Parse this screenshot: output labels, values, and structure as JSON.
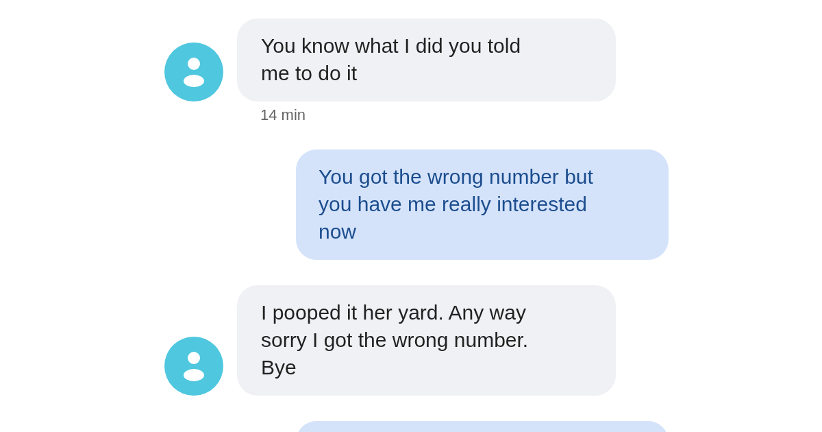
{
  "messages": [
    {
      "kind": "incoming",
      "text": "You know what I did you told\nme to do it",
      "time": "14 min"
    },
    {
      "kind": "outgoing",
      "text": "You got the wrong number but\nyou have me really interested\nnow"
    },
    {
      "kind": "incoming",
      "text": "I pooped it her yard. Any way\nsorry I got the wrong number.\nBye"
    },
    {
      "kind": "outgoing"
    }
  ]
}
